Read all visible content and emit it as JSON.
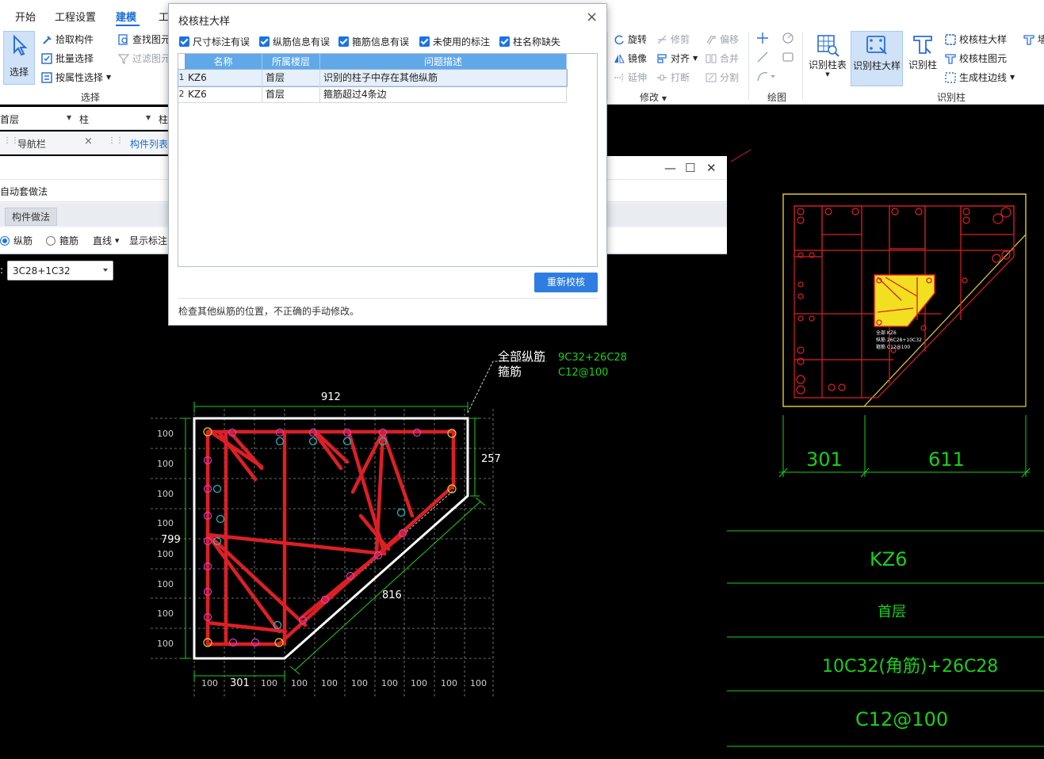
{
  "menu": [
    "开始",
    "工程设置",
    "建模",
    "工"
  ],
  "ribbon": {
    "select_group": {
      "select_btn": "选择",
      "pick_member": "拾取构件",
      "batch_select": "批量选择",
      "select_by_attr": "按属性选择",
      "find_element": "查找图元",
      "filter_element": "过滤图元",
      "label": "选择"
    },
    "modify_group": {
      "rotate": "旋转",
      "trim": "修剪",
      "offset": "偏移",
      "mirror": "镜像",
      "align": "对齐",
      "merge": "合并",
      "extend": "延伸",
      "break": "打断",
      "split": "分割",
      "label": "修改"
    },
    "draw_group": {
      "label": "绘图"
    },
    "identify_group": {
      "identify_col_table": "识别柱表",
      "identify_col_detail": "识别柱大样",
      "identify_col": "识别柱",
      "check_col_detail": "校核柱大样",
      "check_col_element": "校核柱图元",
      "gen_col_edge": "生成柱边线",
      "label": "识别柱",
      "partial_right": "墙"
    }
  },
  "left_panels": {
    "floor_select": "首层",
    "type_select": "柱",
    "type_select2": "柱",
    "nav_tab": "导航栏",
    "component_list_tab": "构件列表",
    "subwin_row2": "自动套做法",
    "subwin_tab": "构件做法",
    "radio_long": "纵筋",
    "radio_stirrup": "箍筋",
    "line_mode": "直线",
    "show_annot": "显示标注",
    "spec_value": "3C28+1C32",
    "spec_prefix": ":"
  },
  "dialog": {
    "title": "校核柱大样",
    "checks": [
      "尺寸标注有误",
      "纵筋信息有误",
      "箍筋信息有误",
      "未使用的标注",
      "柱名称缺失"
    ],
    "columns": [
      "名称",
      "所属楼层",
      "问题描述"
    ],
    "rows": [
      {
        "idx": "1",
        "name": "KZ6",
        "floor": "首层",
        "desc": "识别的柱子中存在其他纵筋"
      },
      {
        "idx": "2",
        "name": "KZ6",
        "floor": "首层",
        "desc": "箍筋超过4条边"
      }
    ],
    "recheck_btn": "重新校核",
    "hint": "检查其他纵筋的位置，不正确的手动修改。"
  },
  "cad_left": {
    "leader_label1": "全部纵筋",
    "leader_label2": "箍筋",
    "leader_value1": "9C32+26C28",
    "leader_value2": "C12@100",
    "dim_top": "912",
    "dim_left": "799",
    "dim_right": "257",
    "dim_diag": "816",
    "dim_bottom": "301",
    "grid_label": "100"
  },
  "cad_right": {
    "dim_bottom_left": "301",
    "dim_bottom_right": "611",
    "mini_text": [
      "全部 KZ6",
      "纵筋 26C28+10C32",
      "箍筋 C12@100"
    ],
    "table": [
      "KZ6",
      "首层",
      "10C32(角筋)+26C28",
      "C12@100"
    ]
  },
  "colors": {
    "cad_bg": "#000000",
    "cad_white": "#ffffff",
    "cad_red": "#e02020",
    "cad_green": "#18d018",
    "cad_yellow": "#f0e020",
    "accent_blue": "#1a73e8",
    "grid_header": "#61a8e9"
  }
}
